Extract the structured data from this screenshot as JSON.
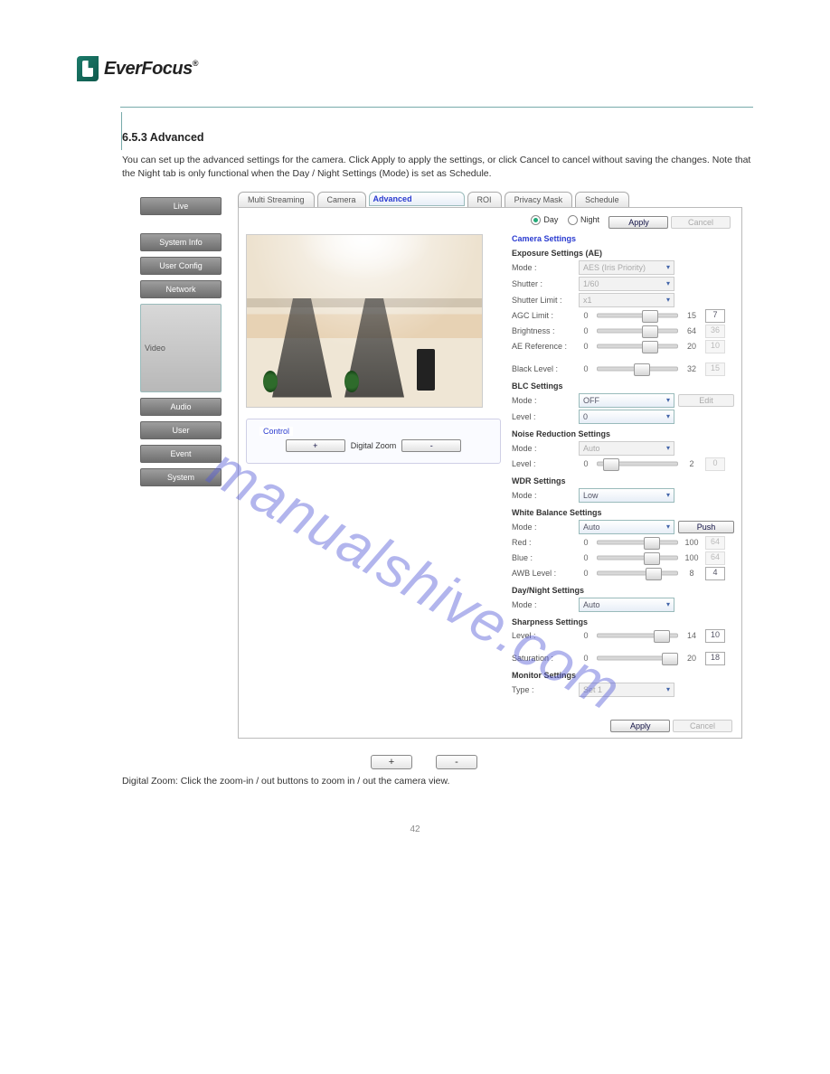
{
  "logo_text": "EverFocus",
  "watermark": "manualshive.com",
  "section_title": "6.5.3  Advanced",
  "intro": "You can set up the advanced settings for the camera. Click Apply to apply the settings, or click Cancel to cancel without saving the changes. Note that the Night tab is only functional when the Day / Night Settings (Mode) is set as Schedule.",
  "sidebar": [
    {
      "label": "Live",
      "sel": false
    },
    {
      "gap": true
    },
    {
      "label": "System Info",
      "sel": false
    },
    {
      "label": "User Config",
      "sel": false
    },
    {
      "label": "Network",
      "sel": false
    },
    {
      "label": "Video",
      "sel": true
    },
    {
      "label": "Audio",
      "sel": false
    },
    {
      "label": "User",
      "sel": false
    },
    {
      "label": "Event",
      "sel": false
    },
    {
      "label": "System",
      "sel": false
    }
  ],
  "tabs": [
    "Multi Streaming",
    "Camera",
    "Advanced",
    "ROI",
    "Privacy Mask",
    "Schedule"
  ],
  "tabs_sel": 2,
  "toprow": {
    "day": "Day",
    "night": "Night",
    "sel": "day",
    "apply": "Apply",
    "cancel": "Cancel"
  },
  "control": {
    "legend": "Control",
    "plus": "+",
    "label": "Digital Zoom",
    "minus": "-"
  },
  "settings": {
    "title": "Camera Settings",
    "exposure": {
      "legend": "Exposure Settings (AE)",
      "mode": {
        "label": "Mode :",
        "value": "AES (Iris Priority)",
        "enabled": false
      },
      "shutter": {
        "label": "Shutter :",
        "value": "1/60",
        "enabled": false
      },
      "shutterLimit": {
        "label": "Shutter Limit :",
        "value": "x1",
        "enabled": false
      },
      "agc": {
        "label": "AGC Limit :",
        "min": "0",
        "max": "15",
        "box": "7",
        "thumb": 55
      },
      "bright": {
        "label": "Brightness :",
        "min": "0",
        "max": "64",
        "box": "36",
        "thumb": 56,
        "box_dis": true
      },
      "aeref": {
        "label": "AE Reference :",
        "min": "0",
        "max": "20",
        "box": "10",
        "thumb": 55,
        "box_dis": true
      },
      "black": {
        "label": "Black Level :",
        "min": "0",
        "max": "32",
        "box": "15",
        "thumb": 45,
        "box_dis": true
      }
    },
    "blc": {
      "legend": "BLC Settings",
      "mode": {
        "label": "Mode :",
        "value": "OFF",
        "enabled": true
      },
      "edit": "Edit",
      "level": {
        "label": "Level :",
        "value": "0",
        "enabled": true
      }
    },
    "nr": {
      "legend": "Noise Reduction Settings",
      "mode": {
        "label": "Mode :",
        "value": "Auto",
        "enabled": false
      },
      "level": {
        "label": "Level :",
        "min": "0",
        "max": "2",
        "box": "0",
        "thumb": 8,
        "box_dis": true
      }
    },
    "wdr": {
      "legend": "WDR Settings",
      "mode": {
        "label": "Mode :",
        "value": "Low",
        "enabled": true
      }
    },
    "wb": {
      "legend": "White Balance Settings",
      "mode": {
        "label": "Mode :",
        "value": "Auto",
        "enabled": true
      },
      "push": "Push",
      "red": {
        "label": "Red :",
        "min": "0",
        "max": "100",
        "box": "64",
        "thumb": 58,
        "box_dis": true
      },
      "blue": {
        "label": "Blue :",
        "min": "0",
        "max": "100",
        "box": "64",
        "thumb": 58,
        "box_dis": true
      },
      "awb": {
        "label": "AWB Level :",
        "min": "0",
        "max": "8",
        "box": "4",
        "thumb": 60
      }
    },
    "daynight": {
      "legend": "Day/Night Settings",
      "mode": {
        "label": "Mode :",
        "value": "Auto",
        "enabled": true
      }
    },
    "sharp": {
      "legend": "Sharpness Settings",
      "level": {
        "label": "Level :",
        "min": "0",
        "max": "14",
        "box": "10",
        "thumb": 70
      }
    },
    "sat": {
      "label": "Saturation :",
      "min": "0",
      "max": "20",
      "box": "18",
      "thumb": 80
    },
    "monitor": {
      "legend": "Monitor Settings",
      "type": {
        "label": "Type :",
        "value": "Set 1",
        "enabled": false
      }
    },
    "footer": {
      "apply": "Apply",
      "cancel": "Cancel"
    }
  },
  "instr": {
    "line": "Digital Zoom: Click the zoom-in / out buttons to zoom in / out the camera view.",
    "plus": "+",
    "minus": "-"
  },
  "page_number": "42"
}
